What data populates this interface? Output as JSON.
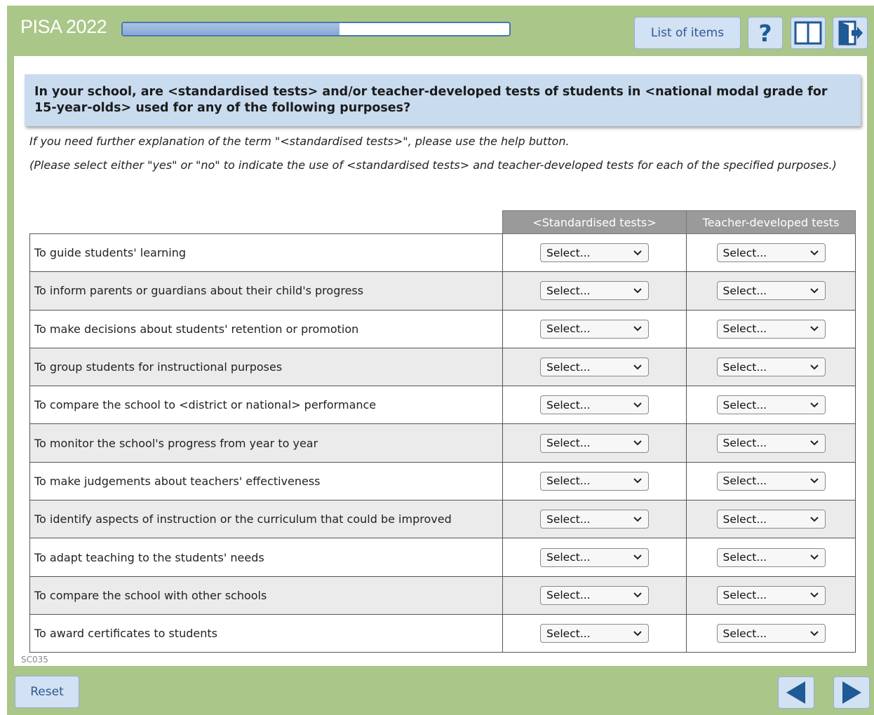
{
  "header": {
    "app_title": "PISA 2022",
    "progress": 0.56,
    "list_of_items_label": "List of items",
    "help_icon": "question-mark-icon",
    "book_icon": "book-icon",
    "exit_icon": "exit-icon"
  },
  "question": {
    "text": "In your school, are <standardised tests> and/or teacher-developed tests of students in <national modal grade for 15-year-olds> used for any of the following purposes?",
    "instruction_1": "If you need further explanation of the term \"<standardised tests>\", please use the help button.",
    "instruction_2": "(Please select either \"yes\" or \"no\" to indicate the use of <standardised tests> and teacher-developed tests for each of the specified purposes.)"
  },
  "table": {
    "columns": [
      "<Standardised tests>",
      "Teacher-developed tests"
    ],
    "select_placeholder": "Select...",
    "rows": [
      "To guide students' learning",
      "To inform parents or guardians about their child's progress",
      "To make decisions about students' retention or promotion",
      "To group students for instructional purposes",
      "To compare the school to <district or national> performance",
      "To monitor the school's progress from year to year",
      "To make judgements about teachers' effectiveness",
      "To identify aspects of instruction or the curriculum that could be improved",
      "To adapt teaching to the students' needs",
      "To compare the school with other schools",
      "To award certificates to students"
    ]
  },
  "footer": {
    "item_code": "SC035",
    "reset_label": "Reset",
    "prev_icon": "previous-arrow-icon",
    "next_icon": "next-arrow-icon"
  },
  "colors": {
    "frame": "#aac689",
    "button_bg": "#d2e1f3",
    "button_text": "#2c5a91",
    "question_bg": "#c9dbef",
    "header_col_bg": "#9a9a9a",
    "arrow": "#1f5996"
  }
}
